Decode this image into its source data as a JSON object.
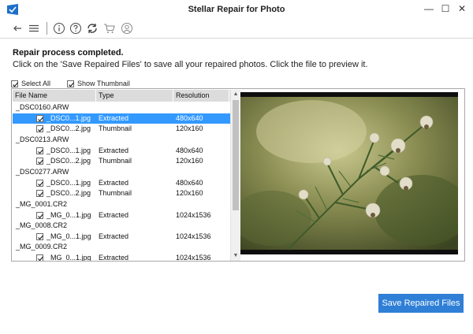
{
  "window": {
    "title": "Stellar Repair for Photo"
  },
  "toolbar": {
    "icons": [
      "back-arrow-icon",
      "menu-icon",
      "info-icon",
      "help-icon",
      "refresh-icon",
      "cart-icon",
      "account-icon"
    ]
  },
  "status": {
    "title": "Repair process completed.",
    "description": "Click on the 'Save Repaired Files' to save all your repaired photos. Click the file to preview it."
  },
  "options": {
    "select_all": {
      "label": "Select All",
      "checked": true
    },
    "show_thumbnail": {
      "label": "Show Thumbnail",
      "checked": true
    }
  },
  "table": {
    "columns": [
      "File Name",
      "Type",
      "Resolution"
    ],
    "groups": [
      {
        "name": "_DSC0160.ARW",
        "files": [
          {
            "name": "_DSC0...1.jpg",
            "type": "Extracted",
            "resolution": "480x640",
            "selected": true
          },
          {
            "name": "_DSC0...2.jpg",
            "type": "Thumbnail",
            "resolution": "120x160",
            "selected": false
          }
        ]
      },
      {
        "name": "_DSC0213.ARW",
        "files": [
          {
            "name": "_DSC0...1.jpg",
            "type": "Extracted",
            "resolution": "480x640",
            "selected": false
          },
          {
            "name": "_DSC0...2.jpg",
            "type": "Thumbnail",
            "resolution": "120x160",
            "selected": false
          }
        ]
      },
      {
        "name": "_DSC0277.ARW",
        "files": [
          {
            "name": "_DSC0...1.jpg",
            "type": "Extracted",
            "resolution": "480x640",
            "selected": false
          },
          {
            "name": "_DSC0...2.jpg",
            "type": "Thumbnail",
            "resolution": "120x160",
            "selected": false
          }
        ]
      },
      {
        "name": "_MG_0001.CR2",
        "files": [
          {
            "name": "_MG_0...1.jpg",
            "type": "Extracted",
            "resolution": "1024x1536",
            "selected": false
          }
        ]
      },
      {
        "name": "_MG_0008.CR2",
        "files": [
          {
            "name": "_MG_0...1.jpg",
            "type": "Extracted",
            "resolution": "1024x1536",
            "selected": false
          }
        ]
      },
      {
        "name": "_MG_0009.CR2",
        "files": [
          {
            "name": "_MG_0...1.jpg",
            "type": "Extracted",
            "resolution": "1024x1536",
            "selected": false
          }
        ]
      }
    ]
  },
  "actions": {
    "save_label": "Save Repaired Files"
  },
  "colors": {
    "accent": "#2f7fd6",
    "selection": "#3399ff",
    "app_logo": "#1d6fc9"
  }
}
